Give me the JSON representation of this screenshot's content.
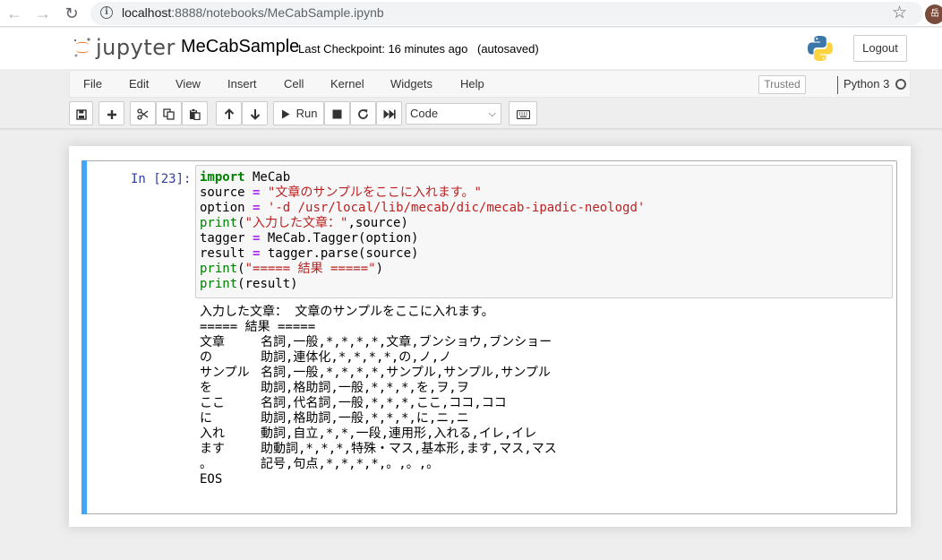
{
  "browser": {
    "url_host": "localhost",
    "url_rest": ":8888/notebooks/MeCabSample.ipynb",
    "profile_initial": "岳"
  },
  "header": {
    "logo_text": "jupyter",
    "notebook_name": "MeCabSample",
    "checkpoint": "Last Checkpoint: 16 minutes ago",
    "autosave_status": "(autosaved)",
    "logout_label": "Logout"
  },
  "menu": {
    "items": [
      "File",
      "Edit",
      "View",
      "Insert",
      "Cell",
      "Kernel",
      "Widgets",
      "Help"
    ],
    "trusted_label": "Trusted",
    "kernel_name": "Python 3"
  },
  "toolbar": {
    "run_label": "Run",
    "cell_type": "Code"
  },
  "cell": {
    "prompt": "In [23]:",
    "code_lines": [
      "import MeCab",
      "source = \"文章のサンプルをここに入れます。\"",
      "option = '-d /usr/local/lib/mecab/dic/mecab-ipadic-neologd'",
      "print(\"入力した文章：\",source)",
      "tagger = MeCab.Tagger(option)",
      "result = tagger.parse(source)",
      "print(\"===== 結果 =====\")",
      "print(result)"
    ],
    "output_lines": [
      "入力した文章： 文章のサンプルをここに入れます。",
      "===== 結果 =====",
      "文章\t名詞,一般,*,*,*,*,文章,ブンショウ,ブンショー",
      "の\t助詞,連体化,*,*,*,*,の,ノ,ノ",
      "サンプル\t名詞,一般,*,*,*,*,サンプル,サンプル,サンプル",
      "を\t助詞,格助詞,一般,*,*,*,を,ヲ,ヲ",
      "ここ\t名詞,代名詞,一般,*,*,*,ここ,ココ,ココ",
      "に\t助詞,格助詞,一般,*,*,*,に,ニ,ニ",
      "入れ\t動詞,自立,*,*,一段,連用形,入れる,イレ,イレ",
      "ます\t助動詞,*,*,*,特殊・マス,基本形,ます,マス,マス",
      "。\t記号,句点,*,*,*,*,。,。,。",
      "EOS"
    ]
  },
  "colors": {
    "accent": "#42a5f5",
    "prompt": "#303f9f",
    "keyword": "#008000",
    "string": "#ba2121",
    "operator": "#aa22ff"
  }
}
